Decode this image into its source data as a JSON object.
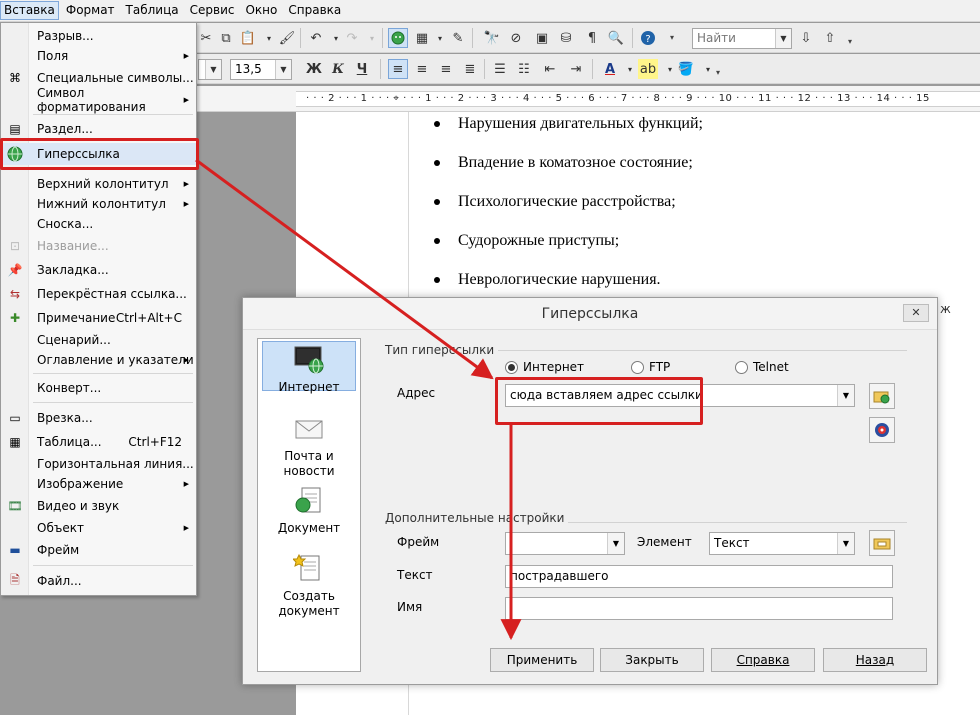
{
  "menubar": {
    "items": [
      "Вставка",
      "Формат",
      "Таблица",
      "Сервис",
      "Окно",
      "Справка"
    ]
  },
  "toolbar": {
    "font_size": "13,5",
    "search_placeholder": "Найти",
    "bold": "Ж",
    "italic": "К",
    "underline": "Ч"
  },
  "ruler": {
    "numbers": "· · · 2 · · · 1 · · · ⌖ · · · 1 · · · 2 · · · 3 · · · 4 · · · 5 · · · 6 · · · 7 · · · 8 · · · 9 · · · 10 · · · 11 · · · 12 · · · 13 · · · 14 · · · 15"
  },
  "document": {
    "bullets": [
      "Нарушения двигательных функций;",
      "Впадение в коматозное состояние;",
      "Психологические расстройства;",
      "Судорожные приступы;",
      "Неврологические нарушения."
    ]
  },
  "insert_menu": {
    "items": [
      {
        "label": "Разрыв...",
        "shortcut": "",
        "sub": false,
        "icon": "none"
      },
      {
        "label": "Поля",
        "shortcut": "",
        "sub": true,
        "icon": "none"
      },
      {
        "label": "Специальные символы...",
        "shortcut": "",
        "sub": false,
        "icon": "special-chars-icon"
      },
      {
        "label": "Символ форматирования",
        "shortcut": "",
        "sub": true,
        "icon": "none"
      },
      {
        "label": "Раздел...",
        "shortcut": "",
        "sub": false,
        "icon": "section-icon"
      },
      {
        "label": "Гиперссылка",
        "shortcut": "",
        "sub": false,
        "icon": "hyperlink-icon"
      },
      {
        "label": "Верхний колонтитул",
        "shortcut": "",
        "sub": true,
        "icon": "none"
      },
      {
        "label": "Нижний колонтитул",
        "shortcut": "",
        "sub": true,
        "icon": "none"
      },
      {
        "label": "Сноска...",
        "shortcut": "",
        "sub": false,
        "icon": "none"
      },
      {
        "label": "Название...",
        "shortcut": "",
        "sub": false,
        "icon": "caption-icon"
      },
      {
        "label": "Закладка...",
        "shortcut": "",
        "sub": false,
        "icon": "bookmark-icon"
      },
      {
        "label": "Перекрёстная ссылка...",
        "shortcut": "",
        "sub": false,
        "icon": "cross-reference-icon"
      },
      {
        "label": "Примечание",
        "shortcut": "Ctrl+Alt+C",
        "sub": false,
        "icon": "comment-icon"
      },
      {
        "label": "Сценарий...",
        "shortcut": "",
        "sub": false,
        "icon": "none"
      },
      {
        "label": "Оглавление и указатели",
        "shortcut": "",
        "sub": true,
        "icon": "none"
      },
      {
        "label": "Конверт...",
        "shortcut": "",
        "sub": false,
        "icon": "none"
      },
      {
        "label": "Врезка...",
        "shortcut": "",
        "sub": false,
        "icon": "frame-icon"
      },
      {
        "label": "Таблица...",
        "shortcut": "Ctrl+F12",
        "sub": false,
        "icon": "table-icon"
      },
      {
        "label": "Горизонтальная линия...",
        "shortcut": "",
        "sub": false,
        "icon": "none"
      },
      {
        "label": "Изображение",
        "shortcut": "",
        "sub": true,
        "icon": "none"
      },
      {
        "label": "Видео и звук",
        "shortcut": "",
        "sub": false,
        "icon": "media-icon"
      },
      {
        "label": "Объект",
        "shortcut": "",
        "sub": true,
        "icon": "none"
      },
      {
        "label": "Фрейм",
        "shortcut": "",
        "sub": false,
        "icon": "floating-frame-icon"
      },
      {
        "label": "Файл...",
        "shortcut": "",
        "sub": false,
        "icon": "file-icon"
      }
    ]
  },
  "dialog": {
    "title": "Гиперссылка",
    "close": "✕",
    "sidebar": [
      "Интернет",
      "Почта и новости",
      "Документ",
      "Создать документ"
    ],
    "type_group": "Тип гиперссылки",
    "radios": [
      "Интернет",
      "FTP",
      "Telnet"
    ],
    "address_label": "Адрес",
    "address_value": "сюда вставляем адрес ссылки",
    "extra_group": "Дополнительные настройки",
    "frame_label": "Фрейм",
    "frame_value": "",
    "element_label": "Элемент",
    "element_value": "Текст",
    "text_label": "Текст",
    "text_value": "пострадавшего",
    "name_label": "Имя",
    "name_value": "",
    "buttons": [
      "Применить",
      "Закрыть",
      "Справка",
      "Назад"
    ]
  },
  "colors": {
    "highlight_red": "#d62020",
    "menu_highlight": "#dbe7f6",
    "selected_blue": "#cde2f8"
  }
}
